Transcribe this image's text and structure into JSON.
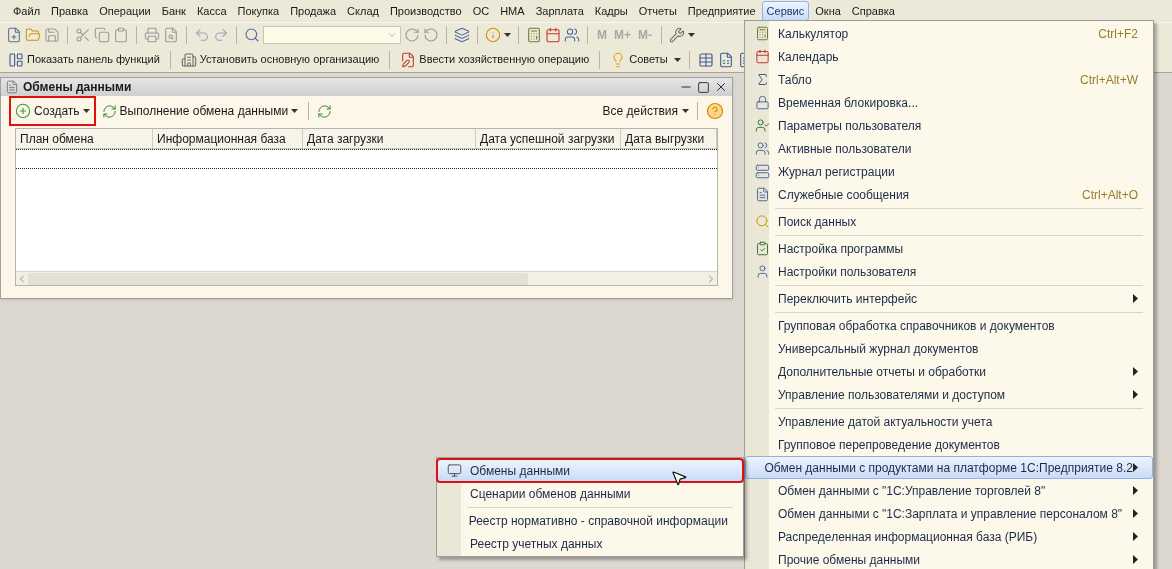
{
  "menu_bar": [
    {
      "label": "Файл",
      "selected": false
    },
    {
      "label": "Правка",
      "selected": false
    },
    {
      "label": "Операции",
      "selected": false
    },
    {
      "label": "Банк",
      "selected": false
    },
    {
      "label": "Касса",
      "selected": false
    },
    {
      "label": "Покупка",
      "selected": false
    },
    {
      "label": "Продажа",
      "selected": false
    },
    {
      "label": "Склад",
      "selected": false
    },
    {
      "label": "Производство",
      "selected": false
    },
    {
      "label": "ОС",
      "selected": false
    },
    {
      "label": "НМА",
      "selected": false
    },
    {
      "label": "Зарплата",
      "selected": false
    },
    {
      "label": "Кадры",
      "selected": false
    },
    {
      "label": "Отчеты",
      "selected": false
    },
    {
      "label": "Предприятие",
      "selected": false
    },
    {
      "label": "Сервис",
      "selected": true
    },
    {
      "label": "Окна",
      "selected": false
    },
    {
      "label": "Справка",
      "selected": false
    }
  ],
  "memory_buttons": [
    {
      "label": "M",
      "disabled": true
    },
    {
      "label": "M+",
      "disabled": true
    },
    {
      "label": "M-",
      "disabled": true
    }
  ],
  "function_toolbar": [
    {
      "label": "Показать панель функций"
    },
    {
      "label": "Установить основную организацию"
    },
    {
      "label": "Ввести хозяйственную операцию"
    },
    {
      "label": "Советы"
    }
  ],
  "window": {
    "title": "Обмены данными",
    "toolbar": {
      "create": {
        "label": "Создать",
        "annotated": true
      },
      "exchange": {
        "label": "Выполнение обмена данными"
      },
      "all_actions": {
        "label": "Все действия"
      }
    },
    "table": {
      "columns": [
        "План обмена",
        "Информационная база",
        "Дата загрузки",
        "Дата успешной загрузки",
        "Дата выгрузки"
      ]
    }
  },
  "service_menu": {
    "items": [
      {
        "kind": "item",
        "label": "Калькулятор",
        "shortcut": "Ctrl+F2",
        "submenu": false,
        "selected": false
      },
      {
        "kind": "item",
        "label": "Календарь",
        "submenu": false,
        "selected": false
      },
      {
        "kind": "item",
        "label": "Табло",
        "shortcut": "Ctrl+Alt+W",
        "submenu": false,
        "selected": false
      },
      {
        "kind": "item",
        "label": "Временная блокировка...",
        "submenu": false,
        "selected": false
      },
      {
        "kind": "item",
        "label": "Параметры пользователя",
        "submenu": false,
        "selected": false
      },
      {
        "kind": "item",
        "label": "Активные пользователи",
        "submenu": false,
        "selected": false
      },
      {
        "kind": "item",
        "label": "Журнал регистрации",
        "submenu": false,
        "selected": false
      },
      {
        "kind": "item",
        "label": "Служебные сообщения",
        "shortcut": "Ctrl+Alt+O",
        "submenu": false,
        "selected": false
      },
      {
        "kind": "separator"
      },
      {
        "kind": "item",
        "label": "Поиск данных",
        "submenu": false,
        "selected": false
      },
      {
        "kind": "separator"
      },
      {
        "kind": "item",
        "label": "Настройка программы",
        "submenu": false,
        "selected": false
      },
      {
        "kind": "item",
        "label": "Настройки пользователя",
        "submenu": false,
        "selected": false
      },
      {
        "kind": "separator"
      },
      {
        "kind": "item",
        "label": "Переключить интерфейс",
        "submenu": true,
        "selected": false
      },
      {
        "kind": "separator"
      },
      {
        "kind": "item",
        "label": "Групповая обработка справочников и документов",
        "submenu": false,
        "selected": false
      },
      {
        "kind": "item",
        "label": "Универсальный журнал документов",
        "submenu": false,
        "selected": false
      },
      {
        "kind": "item",
        "label": "Дополнительные отчеты и обработки",
        "submenu": true,
        "selected": false
      },
      {
        "kind": "item",
        "label": "Управление пользователями и доступом",
        "submenu": true,
        "selected": false
      },
      {
        "kind": "separator"
      },
      {
        "kind": "item",
        "label": "Управление датой актуальности учета",
        "submenu": false,
        "selected": false
      },
      {
        "kind": "item",
        "label": "Групповое перепроведение документов",
        "submenu": false,
        "selected": false
      },
      {
        "kind": "item",
        "label": "Обмен данными с продуктами на платформе 1С:Предприятие 8.2",
        "submenu": true,
        "selected": true
      },
      {
        "kind": "item",
        "label": "Обмен данными с \"1С:Управление торговлей 8\"",
        "submenu": true,
        "selected": false
      },
      {
        "kind": "item",
        "label": "Обмен данными с \"1С:Зарплата и управление персоналом 8\"",
        "submenu": true,
        "selected": false
      },
      {
        "kind": "item",
        "label": "Распределенная информационная база (РИБ)",
        "submenu": true,
        "selected": false
      },
      {
        "kind": "item",
        "label": "Прочие обмены данными",
        "submenu": true,
        "selected": false
      }
    ]
  },
  "submenu": {
    "items": [
      {
        "kind": "item",
        "label": "Обмены данными",
        "selected": true,
        "annotated": true
      },
      {
        "kind": "item",
        "label": "Сценарии обменов данными",
        "selected": false,
        "annotated": false
      },
      {
        "kind": "separator"
      },
      {
        "kind": "item",
        "label": "Реестр нормативно - справочной информации",
        "selected": false,
        "annotated": false
      },
      {
        "kind": "item",
        "label": "Реестр учетных данных",
        "selected": false,
        "annotated": false
      }
    ]
  }
}
